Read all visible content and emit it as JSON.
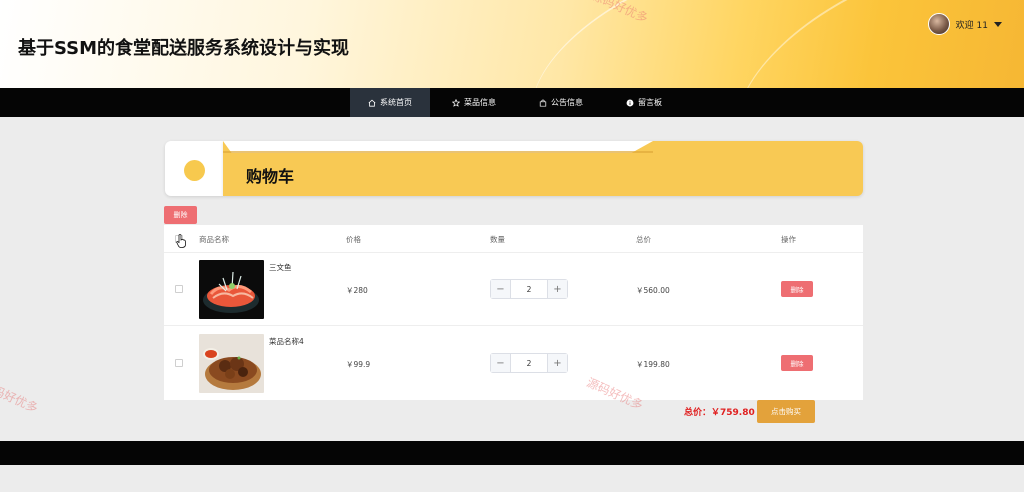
{
  "header": {
    "site_title": "基于SSM的食堂配送服务系统设计与实现",
    "welcome_text": "欢迎 11"
  },
  "nav": {
    "items": [
      {
        "label": "系统首页",
        "icon": "home-icon",
        "active": true
      },
      {
        "label": "菜品信息",
        "icon": "star-icon",
        "active": false
      },
      {
        "label": "公告信息",
        "icon": "bag-icon",
        "active": false
      },
      {
        "label": "留言板",
        "icon": "info-icon",
        "active": false
      }
    ]
  },
  "banner": {
    "title": "购物车"
  },
  "cart": {
    "delete_selected_label": "删除",
    "columns": [
      "商品名称",
      "价格",
      "数量",
      "总价",
      "操作"
    ],
    "rows": [
      {
        "name": "三文鱼",
        "price": "￥280",
        "quantity": "2",
        "total": "￥560.00",
        "delete_label": "删除",
        "image": "salmon-dish"
      },
      {
        "name": "菜品名称4",
        "price": "￥99.9",
        "quantity": "2",
        "total": "￥199.80",
        "delete_label": "删除",
        "image": "grilled-meat-dish"
      }
    ],
    "grand_total_label": "总价：￥759.80",
    "buy_label": "点击购买"
  },
  "watermarks": [
    "源码好优多",
    "源码好优多",
    "源码好优多"
  ],
  "colors": {
    "accent_yellow": "#f8c954",
    "delete_red": "#ee6e72",
    "buy_orange": "#e3a23b",
    "total_red": "#e02020",
    "nav_black": "#050505"
  }
}
